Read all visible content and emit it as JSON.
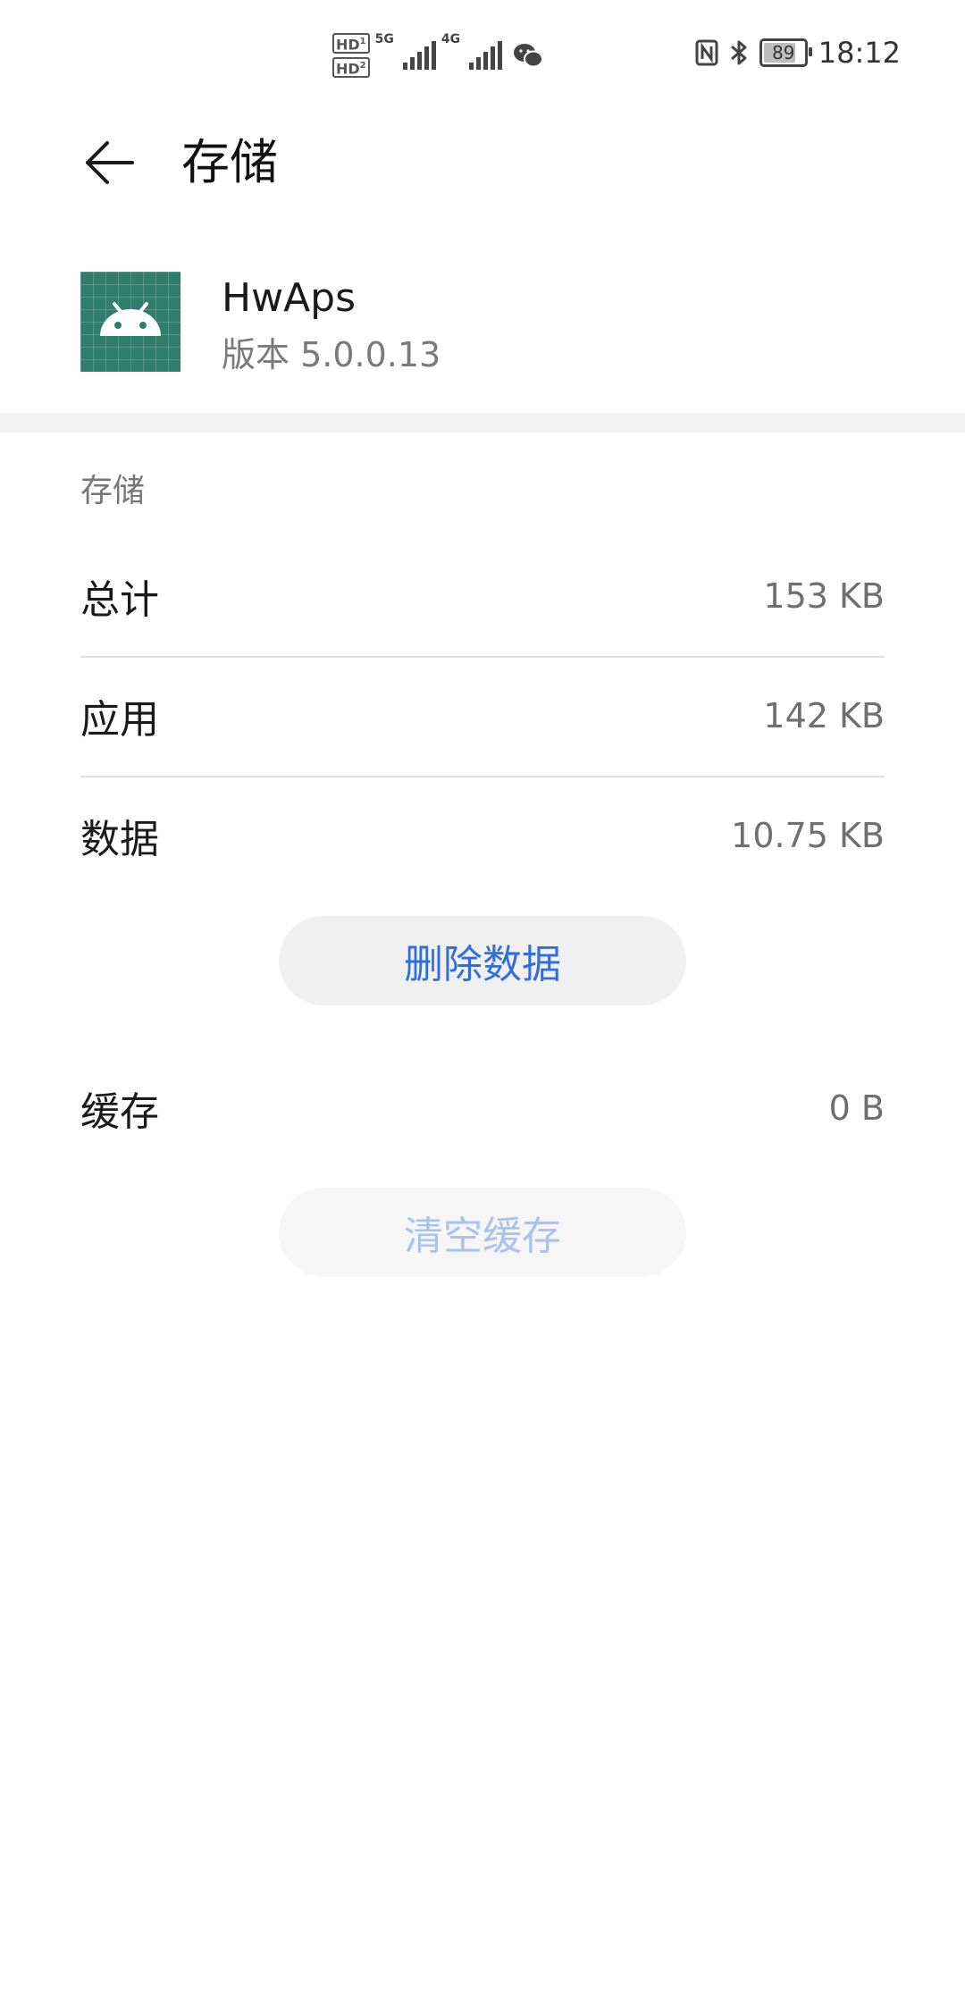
{
  "status_bar": {
    "hd1": "HD",
    "hd1_sub": "1",
    "hd2": "HD",
    "hd2_sub": "2",
    "net1": "5G",
    "net2": "4G",
    "battery": "89",
    "battery_level": 0.89,
    "time": "18:12"
  },
  "header": {
    "title": "存储"
  },
  "app": {
    "name": "HwAps",
    "version": "版本 5.0.0.13"
  },
  "storage": {
    "section_label": "存储",
    "rows": [
      {
        "label": "总计",
        "value": "153 KB"
      },
      {
        "label": "应用",
        "value": "142 KB"
      },
      {
        "label": "数据",
        "value": "10.75 KB"
      }
    ],
    "delete_button": "删除数据",
    "cache": {
      "label": "缓存",
      "value": "0 B"
    },
    "clear_cache_button": "清空缓存"
  },
  "colors": {
    "accent": "#2f6ee0",
    "accent_disabled": "#a9c2f2",
    "app_icon_bg": "#2f7d6c"
  }
}
